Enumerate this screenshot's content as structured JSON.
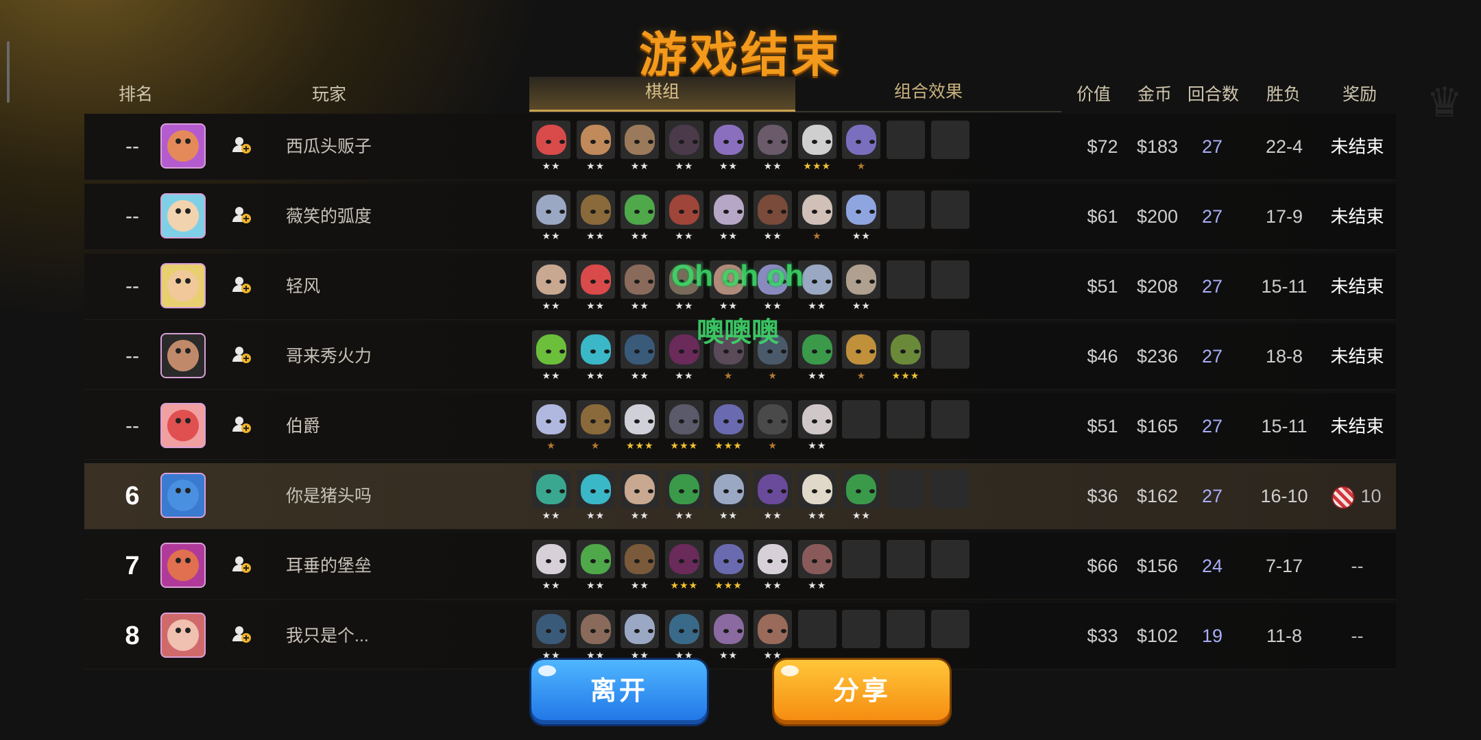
{
  "title": "游戏结束",
  "headers": {
    "rank": "排名",
    "player": "玩家",
    "value": "价值",
    "gold": "金币",
    "rounds": "回合数",
    "wl": "胜负",
    "reward": "奖励"
  },
  "tabs": [
    {
      "label": "棋组",
      "active": true
    },
    {
      "label": "组合效果",
      "active": false
    }
  ],
  "players": [
    {
      "rank": "--",
      "name": "西瓜头贩子",
      "value": "$72",
      "gold": "$183",
      "rounds": "27",
      "wl": "22-4",
      "reward": "未结束",
      "avatar_color": "#e48a5a",
      "avatar_bg": "#b45bd0",
      "units": [
        {
          "c": "#d94a4a",
          "s": 2
        },
        {
          "c": "#c08a5a",
          "s": 2
        },
        {
          "c": "#9a7a5a",
          "s": 2
        },
        {
          "c": "#4a3a4a",
          "s": 2
        },
        {
          "c": "#8a6fbf",
          "s": 2
        },
        {
          "c": "#6a5a6a",
          "s": 2
        },
        {
          "c": "#cfcfcf",
          "s": 3
        },
        {
          "c": "#7a6fbf",
          "s": 1
        },
        null,
        null
      ]
    },
    {
      "rank": "--",
      "name": "薇笑的弧度",
      "value": "$61",
      "gold": "$200",
      "rounds": "27",
      "wl": "17-9",
      "reward": "未结束",
      "avatar_color": "#f2d3b0",
      "avatar_bg": "#7fd0e6",
      "units": [
        {
          "c": "#9aa8c4",
          "s": 2
        },
        {
          "c": "#8a6a3a",
          "s": 2
        },
        {
          "c": "#4fa84a",
          "s": 2
        },
        {
          "c": "#a0453a",
          "s": 2
        },
        {
          "c": "#b7a7c7",
          "s": 2
        },
        {
          "c": "#7a4a3a",
          "s": 2
        },
        {
          "c": "#d0c0b8",
          "s": 1
        },
        {
          "c": "#8fa5e0",
          "s": 2
        },
        null,
        null
      ]
    },
    {
      "rank": "--",
      "name": "轻风",
      "value": "$51",
      "gold": "$208",
      "rounds": "27",
      "wl": "15-11",
      "reward": "未结束",
      "avatar_color": "#f0c89a",
      "avatar_bg": "#e8d070",
      "units": [
        {
          "c": "#c8a890",
          "s": 2
        },
        {
          "c": "#d94a4a",
          "s": 2
        },
        {
          "c": "#8a6a5a",
          "s": 2
        },
        {
          "c": "#7a6a5a",
          "s": 2
        },
        {
          "c": "#b08a7a",
          "s": 2
        },
        {
          "c": "#8a8ac0",
          "s": 2
        },
        {
          "c": "#9aa8c4",
          "s": 2
        },
        {
          "c": "#b0a090",
          "s": 2
        },
        null,
        null
      ]
    },
    {
      "rank": "--",
      "name": "哥来秀火力",
      "value": "$46",
      "gold": "$236",
      "rounds": "27",
      "wl": "18-8",
      "reward": "未结束",
      "avatar_color": "#c08a6a",
      "avatar_bg": "#2a2a2a",
      "units": [
        {
          "c": "#6bbf3a",
          "s": 2
        },
        {
          "c": "#3ab8c8",
          "s": 2
        },
        {
          "c": "#3a5a7a",
          "s": 2
        },
        {
          "c": "#6a2a5a",
          "s": 2
        },
        {
          "c": "#5a4a5a",
          "s": 1
        },
        {
          "c": "#4a5a6a",
          "s": 1
        },
        {
          "c": "#3a9a4a",
          "s": 2
        },
        {
          "c": "#c0903a",
          "s": 1
        },
        {
          "c": "#6a8a3a",
          "s": 3
        },
        null
      ]
    },
    {
      "rank": "--",
      "name": "伯爵",
      "value": "$51",
      "gold": "$165",
      "rounds": "27",
      "wl": "15-11",
      "reward": "未结束",
      "avatar_color": "#e05050",
      "avatar_bg": "#f0a0a0",
      "units": [
        {
          "c": "#b0b8e0",
          "s": 1
        },
        {
          "c": "#8a6a3a",
          "s": 1
        },
        {
          "c": "#d0d0d8",
          "s": 3
        },
        {
          "c": "#5a5a6a",
          "s": 3
        },
        {
          "c": "#6a6ab0",
          "s": 3
        },
        {
          "c": "#4a4a4a",
          "s": 1
        },
        {
          "c": "#d0c8c8",
          "s": 2
        },
        null,
        null,
        null
      ]
    },
    {
      "rank": "6",
      "name": "你是猪头吗",
      "value": "$36",
      "gold": "$162",
      "rounds": "27",
      "wl": "16-10",
      "reward": "10",
      "reward_candy": true,
      "avatar_color": "#4a90e0",
      "avatar_bg": "#3a7ad0",
      "units": [
        {
          "c": "#3aa890",
          "s": 2
        },
        {
          "c": "#3ab8c8",
          "s": 2
        },
        {
          "c": "#c8a890",
          "s": 2
        },
        {
          "c": "#3a9a4a",
          "s": 2
        },
        {
          "c": "#9aa8c4",
          "s": 2
        },
        {
          "c": "#6a4a9a",
          "s": 2
        },
        {
          "c": "#e0d8c8",
          "s": 2
        },
        {
          "c": "#3a9a4a",
          "s": 2
        },
        null,
        null
      ]
    },
    {
      "rank": "7",
      "name": "耳垂的堡垒",
      "value": "$66",
      "gold": "$156",
      "rounds": "24",
      "wl": "7-17",
      "reward": "--",
      "avatar_color": "#e07050",
      "avatar_bg": "#b03a9a",
      "units": [
        {
          "c": "#d8d0d8",
          "s": 2
        },
        {
          "c": "#4fa84a",
          "s": 2
        },
        {
          "c": "#7a5a3a",
          "s": 2
        },
        {
          "c": "#6a2a5a",
          "s": 3
        },
        {
          "c": "#6a6ab0",
          "s": 3
        },
        {
          "c": "#d8d0d8",
          "s": 2
        },
        {
          "c": "#8a5a5a",
          "s": 2
        },
        null,
        null,
        null
      ]
    },
    {
      "rank": "8",
      "name": "我只是个...",
      "value": "$33",
      "gold": "$102",
      "rounds": "19",
      "wl": "11-8",
      "reward": "--",
      "avatar_color": "#f0c0b0",
      "avatar_bg": "#d06a6a",
      "units": [
        {
          "c": "#3a5a7a",
          "s": 2
        },
        {
          "c": "#8a6a5a",
          "s": 2
        },
        {
          "c": "#9aa8c4",
          "s": 2
        },
        {
          "c": "#3a6a8a",
          "s": 2
        },
        {
          "c": "#8a6aa0",
          "s": 2
        },
        {
          "c": "#9a6a5a",
          "s": 2
        },
        null,
        null,
        null,
        null
      ]
    }
  ],
  "overlay": {
    "line1": "Oh oh oh",
    "line2": "噢噢噢"
  },
  "buttons": {
    "leave": "离开",
    "share": "分享"
  },
  "colors": {
    "title": "#f39a1c",
    "rounds": "#a9aef7",
    "leave": "#1f74e6",
    "share": "#f5890f",
    "overlay": "#3ed66a"
  }
}
